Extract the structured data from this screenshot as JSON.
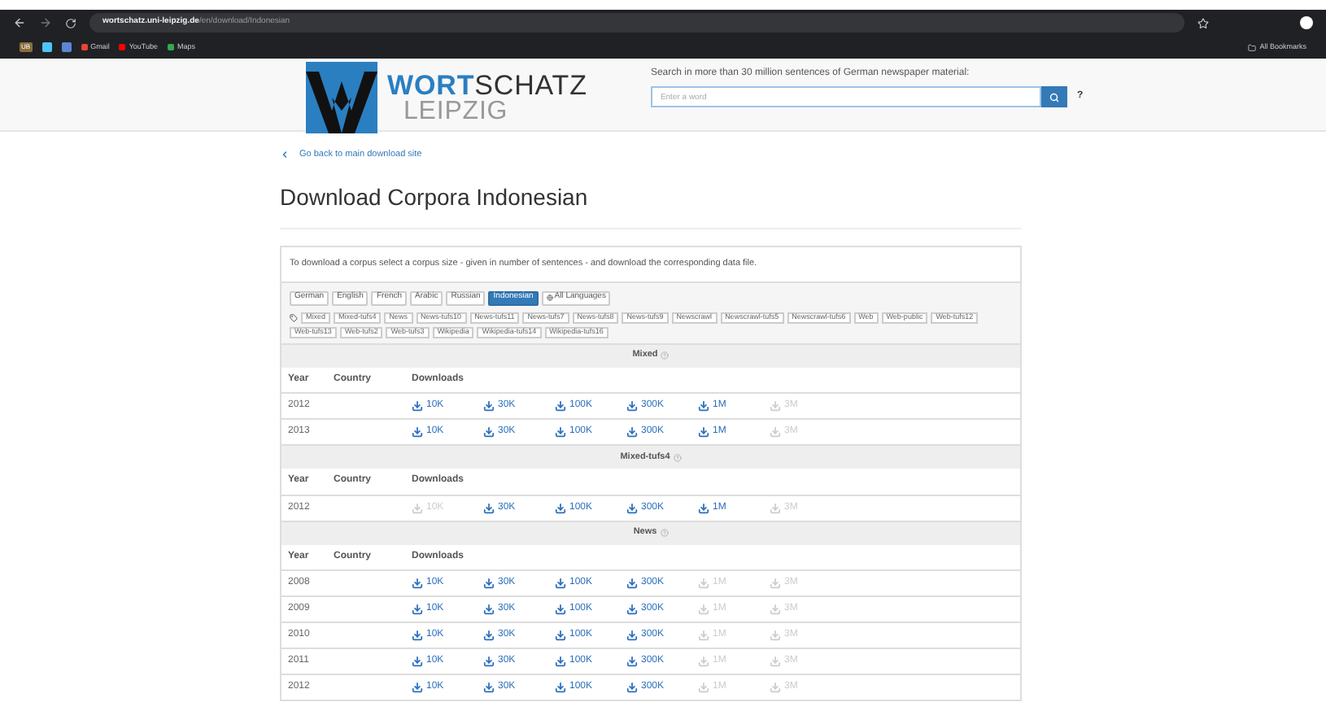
{
  "browser": {
    "url_host": "wortschatz.uni-leipzig.de",
    "url_path": "/en/download/Indonesian",
    "bookmarks": [
      {
        "kind": "favicon",
        "label": "UB",
        "color": "#8a6d3b"
      },
      {
        "kind": "favicon",
        "color": "#4fc3f7"
      },
      {
        "kind": "favicon",
        "color": "#5c85d6"
      },
      {
        "kind": "link",
        "label": "Gmail",
        "color": "#ea4335"
      },
      {
        "kind": "link",
        "label": "YouTube",
        "color": "#ff0000"
      },
      {
        "kind": "link",
        "label": "Maps",
        "color": "#34a853"
      }
    ],
    "all_bookmarks": "All Bookmarks"
  },
  "header": {
    "logo_top_a": "WORT",
    "logo_top_b": "SCHATZ",
    "logo_bottom": "LEIPZIG",
    "search_label": "Search in more than 30 million sentences of German newspaper material:",
    "search": {
      "placeholder": "Enter a word"
    },
    "help": "?"
  },
  "back_link": "Go back to main download site",
  "title": "Download Corpora Indonesian",
  "intro": "To download a corpus select a corpus size - given in number of sentences - and download the corresponding data file.",
  "languages": [
    {
      "label": "German",
      "selected": false
    },
    {
      "label": "English",
      "selected": false
    },
    {
      "label": "French",
      "selected": false
    },
    {
      "label": "Arabic",
      "selected": false
    },
    {
      "label": "Russian",
      "selected": false
    },
    {
      "label": "Indonesian",
      "selected": true
    },
    {
      "label": "All Languages",
      "selected": false
    }
  ],
  "corpus_types": [
    "Mixed",
    "Mixed-tufs4",
    "News",
    "News-tufs10",
    "News-tufs11",
    "News-tufs7",
    "News-tufs8",
    "News-tufs9",
    "Newscrawl",
    "Newscrawl-tufs5",
    "Newscrawl-tufs6",
    "Web",
    "Web-public",
    "Web-tufs12",
    "Web-tufs13",
    "Web-tufs2",
    "Web-tufs3",
    "Wikipedia",
    "Wikipedia-tufs14",
    "Wikipedia-tufs16"
  ],
  "sections": [
    {
      "name": "Mixed",
      "columns": [
        "Year",
        "Country",
        "Downloads"
      ],
      "rows": [
        {
          "year": "2012",
          "downloads": [
            {
              "label": "10K",
              "available": true
            },
            {
              "label": "30K",
              "available": true
            },
            {
              "label": "100K",
              "available": true
            },
            {
              "label": "300K",
              "available": true
            },
            {
              "label": "1M",
              "available": true
            },
            {
              "label": "3M",
              "available": false
            }
          ]
        },
        {
          "year": "2013",
          "downloads": [
            {
              "label": "10K",
              "available": true
            },
            {
              "label": "30K",
              "available": true
            },
            {
              "label": "100K",
              "available": true
            },
            {
              "label": "300K",
              "available": true
            },
            {
              "label": "1M",
              "available": true
            },
            {
              "label": "3M",
              "available": false
            }
          ]
        }
      ]
    },
    {
      "name": "Mixed-tufs4",
      "columns": [
        "Year",
        "Country",
        "Downloads"
      ],
      "rows": [
        {
          "year": "2012",
          "downloads": [
            {
              "label": "10K",
              "available": false
            },
            {
              "label": "30K",
              "available": true
            },
            {
              "label": "100K",
              "available": true
            },
            {
              "label": "300K",
              "available": true
            },
            {
              "label": "1M",
              "available": true
            },
            {
              "label": "3M",
              "available": false
            }
          ]
        }
      ]
    },
    {
      "name": "News",
      "columns": [
        "Year",
        "Country",
        "Downloads"
      ],
      "rows": [
        {
          "year": "2008",
          "downloads": [
            {
              "label": "10K",
              "available": true
            },
            {
              "label": "30K",
              "available": true
            },
            {
              "label": "100K",
              "available": true
            },
            {
              "label": "300K",
              "available": true
            },
            {
              "label": "1M",
              "available": false
            },
            {
              "label": "3M",
              "available": false
            }
          ]
        },
        {
          "year": "2009",
          "downloads": [
            {
              "label": "10K",
              "available": true
            },
            {
              "label": "30K",
              "available": true
            },
            {
              "label": "100K",
              "available": true
            },
            {
              "label": "300K",
              "available": true
            },
            {
              "label": "1M",
              "available": false
            },
            {
              "label": "3M",
              "available": false
            }
          ]
        },
        {
          "year": "2010",
          "downloads": [
            {
              "label": "10K",
              "available": true
            },
            {
              "label": "30K",
              "available": true
            },
            {
              "label": "100K",
              "available": true
            },
            {
              "label": "300K",
              "available": true
            },
            {
              "label": "1M",
              "available": false
            },
            {
              "label": "3M",
              "available": false
            }
          ]
        },
        {
          "year": "2011",
          "downloads": [
            {
              "label": "10K",
              "available": true
            },
            {
              "label": "30K",
              "available": true
            },
            {
              "label": "100K",
              "available": true
            },
            {
              "label": "300K",
              "available": true
            },
            {
              "label": "1M",
              "available": false
            },
            {
              "label": "3M",
              "available": false
            }
          ]
        },
        {
          "year": "2012",
          "downloads": [
            {
              "label": "10K",
              "available": true
            },
            {
              "label": "30K",
              "available": true
            },
            {
              "label": "100K",
              "available": true
            },
            {
              "label": "300K",
              "available": true
            },
            {
              "label": "1M",
              "available": false
            },
            {
              "label": "3M",
              "available": false
            }
          ]
        }
      ]
    }
  ]
}
